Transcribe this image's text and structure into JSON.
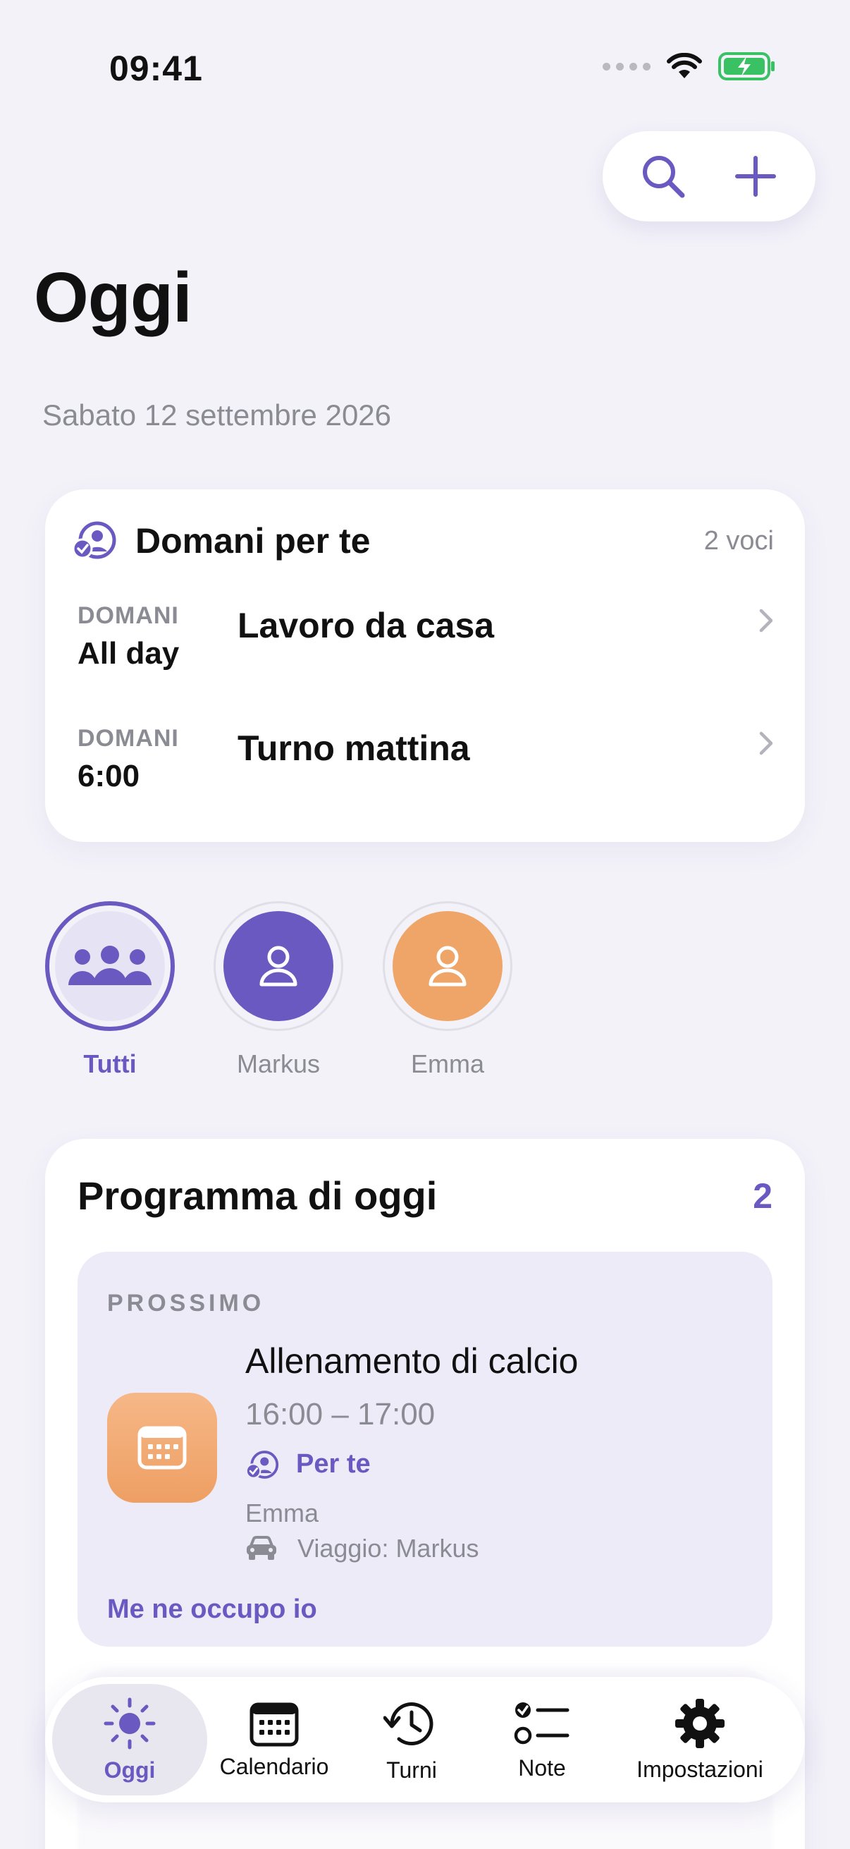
{
  "status": {
    "time": "09:41"
  },
  "header": {
    "title": "Oggi",
    "date": "Sabato 12 settembre 2026"
  },
  "tomorrow": {
    "title": "Domani per te",
    "count": "2 voci",
    "items": [
      {
        "day": "DOMANI",
        "time": "All day",
        "name": "Lavoro da casa"
      },
      {
        "day": "DOMANI",
        "time": "6:00",
        "name": "Turno mattina"
      }
    ]
  },
  "people": [
    {
      "name": "Tutti",
      "color": "#e6e4f4"
    },
    {
      "name": "Markus",
      "color": "#6a59c0"
    },
    {
      "name": "Emma",
      "color": "#eea567"
    }
  ],
  "schedule": {
    "title": "Programma di oggi",
    "count": "2",
    "next": {
      "label": "PROSSIMO",
      "title": "Allenamento di calcio",
      "time": "16:00 – 17:00",
      "for_me": "Per te",
      "person": "Emma",
      "travel": "Viaggio: Markus",
      "action": "Me ne occupo io"
    }
  },
  "tabs": [
    {
      "label": "Oggi",
      "icon": "sun-icon"
    },
    {
      "label": "Calendario",
      "icon": "calendar-icon"
    },
    {
      "label": "Turni",
      "icon": "history-icon"
    },
    {
      "label": "Note",
      "icon": "checklist-icon"
    },
    {
      "label": "Impostazioni",
      "icon": "gear-icon"
    }
  ],
  "colors": {
    "accent": "#6a59c0",
    "background": "#f3f2f9",
    "orange": "#eea567"
  }
}
